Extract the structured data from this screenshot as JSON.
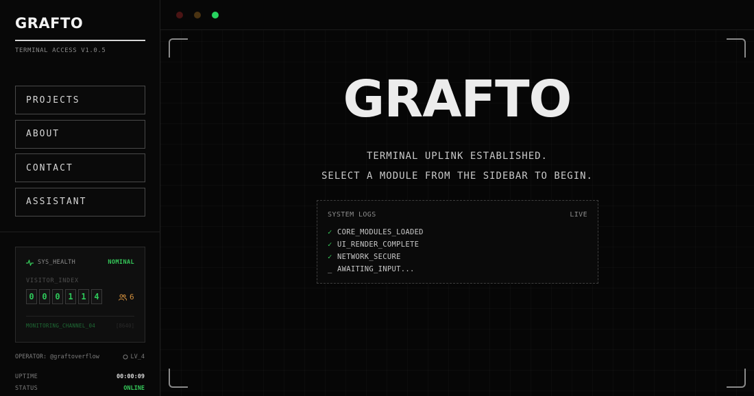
{
  "sidebar": {
    "brand": "GRAFTO",
    "version": "TERMINAL ACCESS V1.0.5",
    "nav": [
      {
        "label": "PROJECTS"
      },
      {
        "label": "ABOUT"
      },
      {
        "label": "CONTACT"
      },
      {
        "label": "ASSISTANT"
      }
    ],
    "health": {
      "label": "SYS_HEALTH",
      "status": "NOMINAL",
      "visitor_label": "VISITOR_INDEX",
      "digits": [
        "0",
        "0",
        "0",
        "1",
        "1",
        "4"
      ],
      "users": "6",
      "channel": "MONITORING_CHANNEL_04",
      "port": "[8640]"
    },
    "operator": "OPERATOR: @graftoverflow",
    "level": "LV_4",
    "uptime_label": "UPTIME",
    "uptime": "00:00:09",
    "status_label": "STATUS",
    "status": "ONLINE"
  },
  "main": {
    "title": "GRAFTO",
    "line1": "TERMINAL UPLINK ESTABLISHED.",
    "line2": "SELECT A MODULE FROM THE SIDEBAR TO BEGIN.",
    "logs": {
      "title": "SYSTEM LOGS",
      "badge": "LIVE",
      "items": [
        {
          "mark": "✓",
          "text": "CORE_MODULES_LOADED"
        },
        {
          "mark": "✓",
          "text": "UI_RENDER_COMPLETE"
        },
        {
          "mark": "✓",
          "text": "NETWORK_SECURE"
        },
        {
          "mark": "_",
          "text": "AWAITING_INPUT..."
        }
      ]
    }
  },
  "colors": {
    "accent_green": "#35c759",
    "warning_orange": "#d3903e"
  }
}
